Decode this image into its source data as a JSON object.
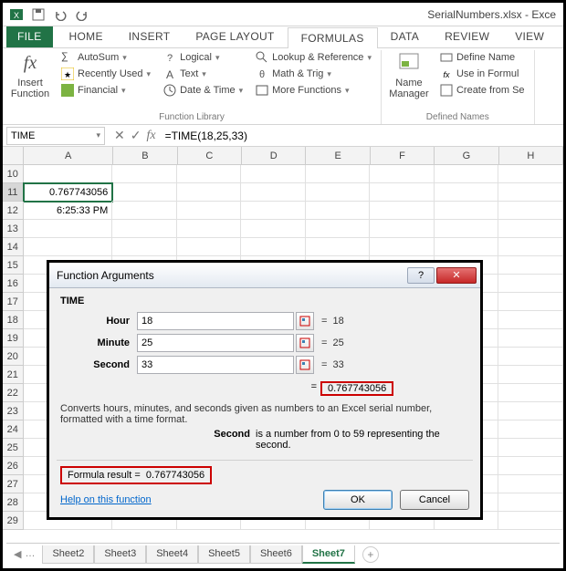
{
  "title": "SerialNumbers.xlsx - Exce",
  "ribbon_tabs": {
    "file": "FILE",
    "home": "HOME",
    "insert": "INSERT",
    "page_layout": "PAGE LAYOUT",
    "formulas": "FORMULAS",
    "data": "DATA",
    "review": "REVIEW",
    "view": "VIEW"
  },
  "ribbon": {
    "insert_function": "Insert\nFunction",
    "autosum": "AutoSum",
    "recently_used": "Recently Used",
    "financial": "Financial",
    "logical": "Logical",
    "text": "Text",
    "date_time": "Date & Time",
    "lookup": "Lookup & Reference",
    "math_trig": "Math & Trig",
    "more_functions": "More Functions",
    "function_library": "Function Library",
    "name_manager": "Name\nManager",
    "define_name": "Define Name",
    "use_in_formula": "Use in Formul",
    "create_from": "Create from Se",
    "defined_names": "Defined Names"
  },
  "name_box": "TIME",
  "formula": "=TIME(18,25,33)",
  "columns": [
    "A",
    "B",
    "C",
    "D",
    "E",
    "F",
    "G",
    "H"
  ],
  "row_start": 10,
  "row_end": 29,
  "cells": {
    "A11": "0.767743056",
    "A12": "6:25:33 PM"
  },
  "dialog": {
    "title": "Function Arguments",
    "func": "TIME",
    "args": [
      {
        "label": "Hour",
        "value": "18",
        "result": "18"
      },
      {
        "label": "Minute",
        "value": "25",
        "result": "25"
      },
      {
        "label": "Second",
        "value": "33",
        "result": "33"
      }
    ],
    "func_result": "0.767743056",
    "desc": "Converts hours, minutes, and seconds given as numbers to an Excel serial number, formatted with a time format.",
    "arg_desc_label": "Second",
    "arg_desc_text": "is a number from 0 to 59 representing the second.",
    "formula_result_label": "Formula result =",
    "formula_result_value": "0.767743056",
    "help": "Help on this function",
    "ok": "OK",
    "cancel": "Cancel"
  },
  "sheet_tabs": [
    "Sheet2",
    "Sheet3",
    "Sheet4",
    "Sheet5",
    "Sheet6",
    "Sheet7"
  ],
  "active_sheet": "Sheet7"
}
